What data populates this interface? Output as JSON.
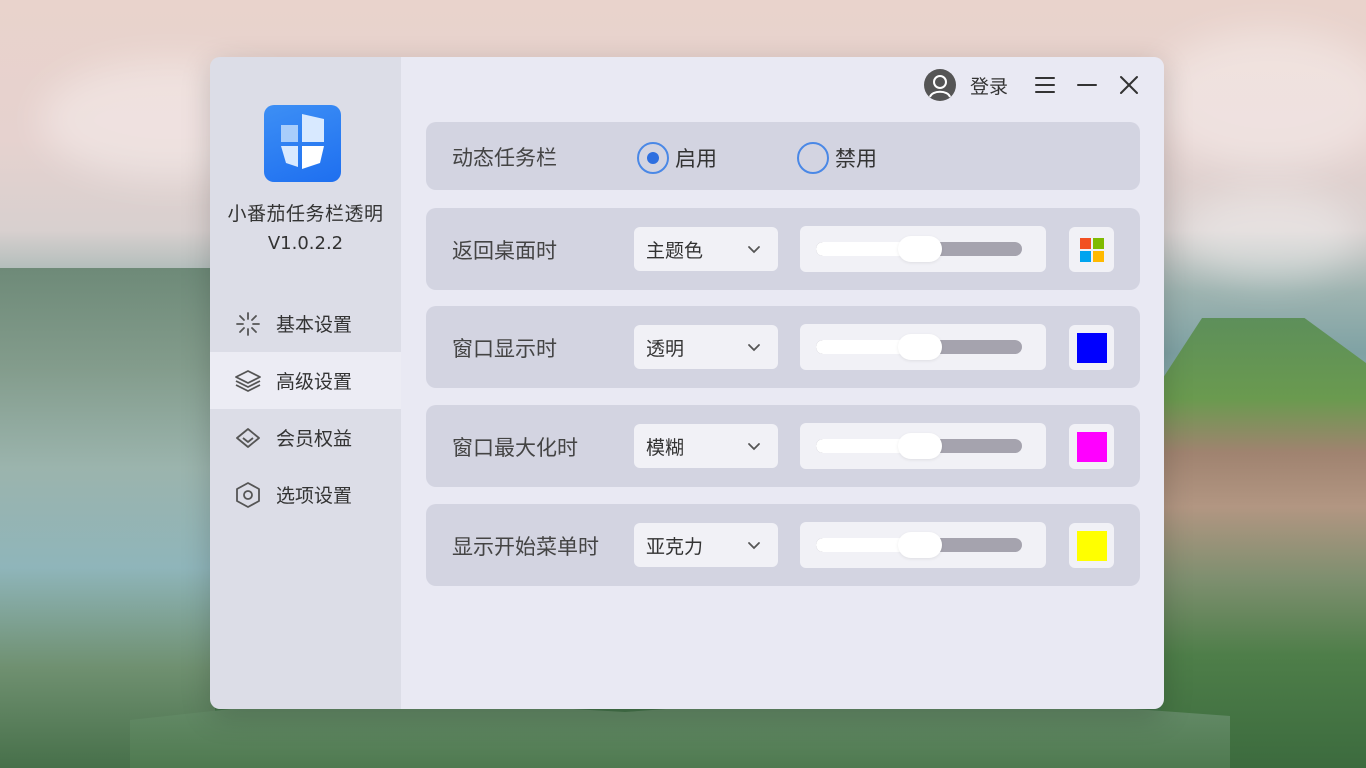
{
  "app": {
    "name": "小番茄任务栏透明",
    "version": "V1.0.2.2"
  },
  "sidebar": {
    "items": [
      {
        "label": "基本设置",
        "icon": "sparkle-icon",
        "active": false
      },
      {
        "label": "高级设置",
        "icon": "layers-icon",
        "active": true
      },
      {
        "label": "会员权益",
        "icon": "diamond-icon",
        "active": false
      },
      {
        "label": "选项设置",
        "icon": "hexagon-settings-icon",
        "active": false
      }
    ]
  },
  "titlebar": {
    "login_label": "登录",
    "icons": [
      "user-avatar-icon",
      "menu-icon",
      "minimize-icon",
      "close-icon"
    ]
  },
  "settings": {
    "dynamic_taskbar": {
      "label": "动态任务栏",
      "options": [
        {
          "label": "启用",
          "selected": true
        },
        {
          "label": "禁用",
          "selected": false
        }
      ]
    },
    "rows": [
      {
        "label": "返回桌面时",
        "mode": "主题色",
        "slider_value": 0.5,
        "color": "windows-logo"
      },
      {
        "label": "窗口显示时",
        "mode": "透明",
        "slider_value": 0.5,
        "color": "#0000ff"
      },
      {
        "label": "窗口最大化时",
        "mode": "模糊",
        "slider_value": 0.5,
        "color": "#ff00ff"
      },
      {
        "label": "显示开始菜单时",
        "mode": "亚克力",
        "slider_value": 0.5,
        "color": "#ffff00"
      }
    ]
  },
  "colors": {
    "accent": "#2e6fe0",
    "sidebar_bg": "#dcdde7",
    "main_bg": "#e9e9f3",
    "row_bg": "#d3d4e1"
  }
}
